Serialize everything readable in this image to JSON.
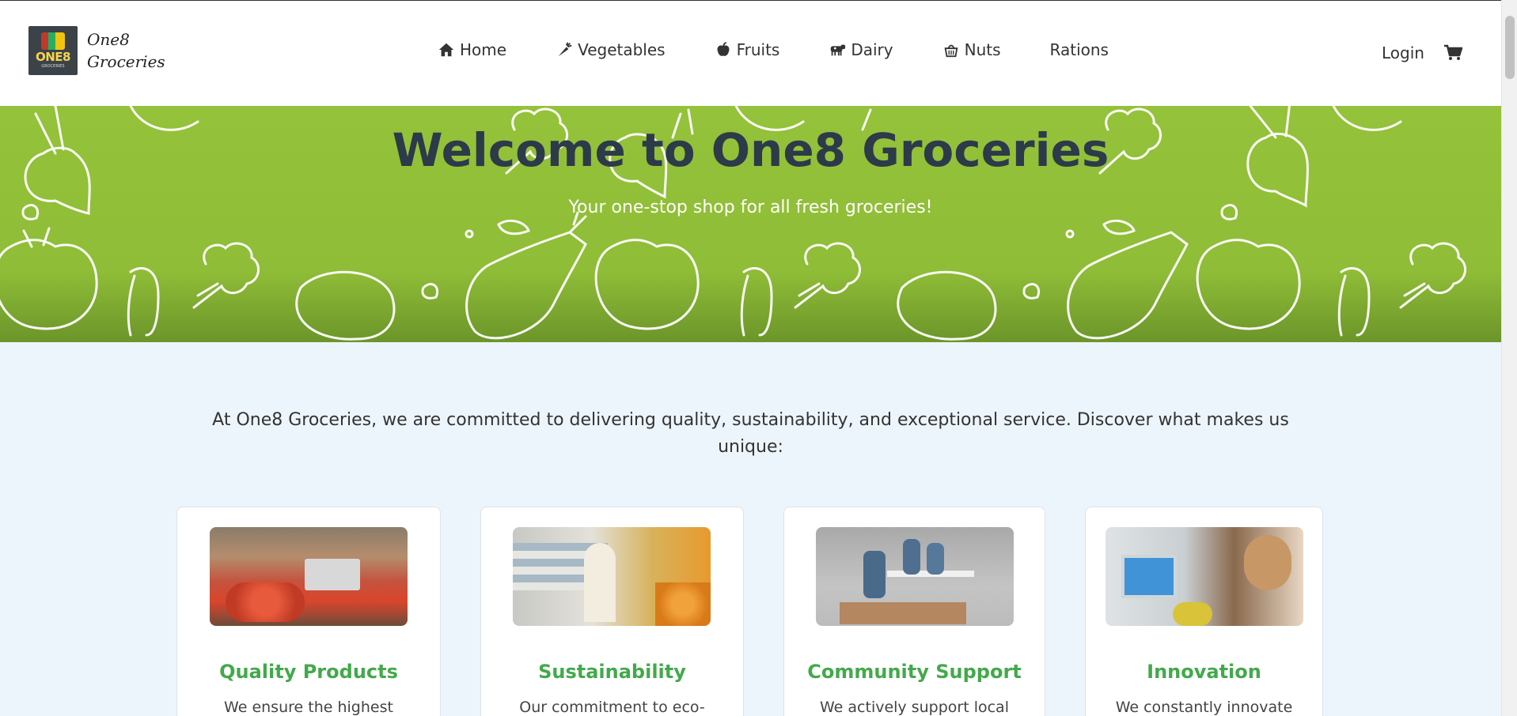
{
  "brand": {
    "logo_word": "ONE8",
    "logo_sub": "GROCERIES",
    "name_line1": "One8",
    "name_line2": "Groceries"
  },
  "nav": {
    "items": [
      {
        "label": "Home",
        "icon": "home-icon"
      },
      {
        "label": "Vegetables",
        "icon": "carrot-icon"
      },
      {
        "label": "Fruits",
        "icon": "apple-icon"
      },
      {
        "label": "Dairy",
        "icon": "cow-icon"
      },
      {
        "label": "Nuts",
        "icon": "nut-basket-icon"
      },
      {
        "label": "Rations",
        "icon": ""
      }
    ],
    "login_label": "Login",
    "cart_icon": "cart-icon"
  },
  "hero": {
    "title": "Welcome to One8 Groceries",
    "subtitle": "Your one-stop shop for all fresh groceries!"
  },
  "intro": {
    "text": "At One8 Groceries, we are committed to delivering quality, sustainability, and exceptional service. Discover what makes us unique:"
  },
  "cards": [
    {
      "title": "Quality Products",
      "desc": "We ensure the highest"
    },
    {
      "title": "Sustainability",
      "desc": "Our commitment to eco-"
    },
    {
      "title": "Community Support",
      "desc": "We actively support local"
    },
    {
      "title": "Innovation",
      "desc": "We constantly innovate"
    }
  ],
  "colors": {
    "accent_green": "#43a94b",
    "hero_green": "#94c23a",
    "hero_title": "#2d3a4a",
    "page_bg": "#edf5fc"
  }
}
